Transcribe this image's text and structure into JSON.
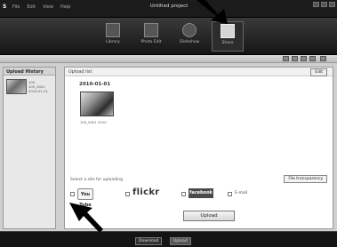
{
  "app": {
    "title": "Untitled project",
    "logo": "S"
  },
  "menu": [
    "File",
    "Edit",
    "View",
    "Help"
  ],
  "modes": [
    {
      "label": "Library",
      "icon": "library-icon"
    },
    {
      "label": "Photo Edit",
      "icon": "photo-edit-icon"
    },
    {
      "label": "Slideshow",
      "icon": "slideshow-icon"
    },
    {
      "label": "Share",
      "icon": "share-icon",
      "active": true
    }
  ],
  "sidebar": {
    "title": "Upload History",
    "item": {
      "line1": "100",
      "line2": "105_0001",
      "line3": "2010-01-01"
    }
  },
  "main": {
    "header": "Upload list",
    "edit_label": "Edit",
    "date": "2010-01-01",
    "thumb_meta": "105_0001 2010"
  },
  "sites": {
    "prompt": "Select a site for uploading",
    "file_transparency": "File transparency",
    "youtube": "You Tube",
    "flickr": "flickr",
    "facebook": "facebook",
    "epage": "E-mail"
  },
  "upload_label": "Upload",
  "status_tabs": [
    "Download",
    "Upload"
  ],
  "colors": {
    "arrow": "#000000",
    "bar": "#141414"
  }
}
